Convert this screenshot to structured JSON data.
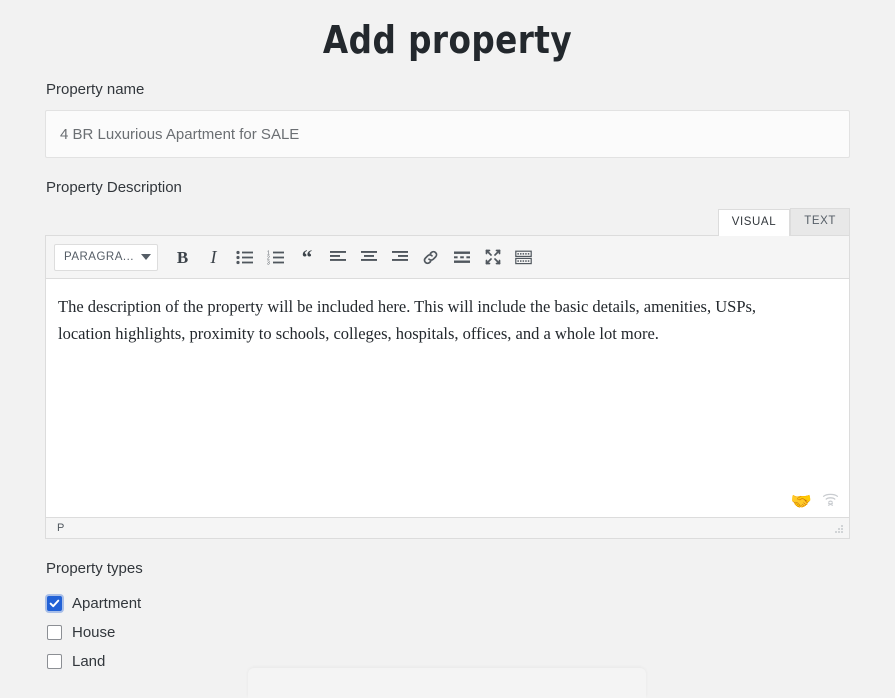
{
  "page": {
    "title": "Add property",
    "background_color": "#f2f2f2"
  },
  "property_name_field": {
    "label": "Property name",
    "value": "4 BR Luxurious Apartment for SALE",
    "placeholder": "Property name"
  },
  "property_description_field": {
    "label": "Property Description",
    "tabs": [
      {
        "label": "VISUAL",
        "active": true
      },
      {
        "label": "TEXT",
        "active": false
      }
    ],
    "toolbar": {
      "format_select": {
        "value": "PARAGRA...",
        "full_value": "PARAGRAPH"
      },
      "buttons": [
        {
          "name": "bold-icon",
          "label": "B",
          "title": "Bold"
        },
        {
          "name": "italic-icon",
          "label": "I",
          "title": "Italic"
        },
        {
          "name": "bulleted-list-icon",
          "label": "",
          "title": "Bulleted list"
        },
        {
          "name": "numbered-list-icon",
          "label": "",
          "title": "Numbered list"
        },
        {
          "name": "blockquote-icon",
          "label": "“",
          "title": "Blockquote"
        },
        {
          "name": "align-left-icon",
          "label": "",
          "title": "Align left"
        },
        {
          "name": "align-center-icon",
          "label": "",
          "title": "Align center"
        },
        {
          "name": "align-right-icon",
          "label": "",
          "title": "Align right"
        },
        {
          "name": "link-icon",
          "label": "",
          "title": "Insert/edit link"
        },
        {
          "name": "read-more-icon",
          "label": "",
          "title": "Insert Read More tag"
        },
        {
          "name": "fullscreen-icon",
          "label": "",
          "title": "Distraction-free writing mode"
        },
        {
          "name": "toolbar-toggle-icon",
          "label": "",
          "title": "Toolbar Toggle"
        }
      ]
    },
    "content": "The description of the property will be included here. This will include the basic details, amenities, USPs, location highlights, proximity to schools, colleges, hospitals, offices, and a whole lot more.",
    "corner_icons": [
      {
        "name": "handshake-icon",
        "glyph": "🤝"
      },
      {
        "name": "wifi-disconnected-icon",
        "glyph": ""
      }
    ],
    "statusbar": {
      "path": "P"
    }
  },
  "property_types": {
    "label": "Property types",
    "accent_color": "#2161d6",
    "options": [
      {
        "label": "Apartment",
        "checked": true
      },
      {
        "label": "House",
        "checked": false
      },
      {
        "label": "Land",
        "checked": false
      }
    ]
  }
}
